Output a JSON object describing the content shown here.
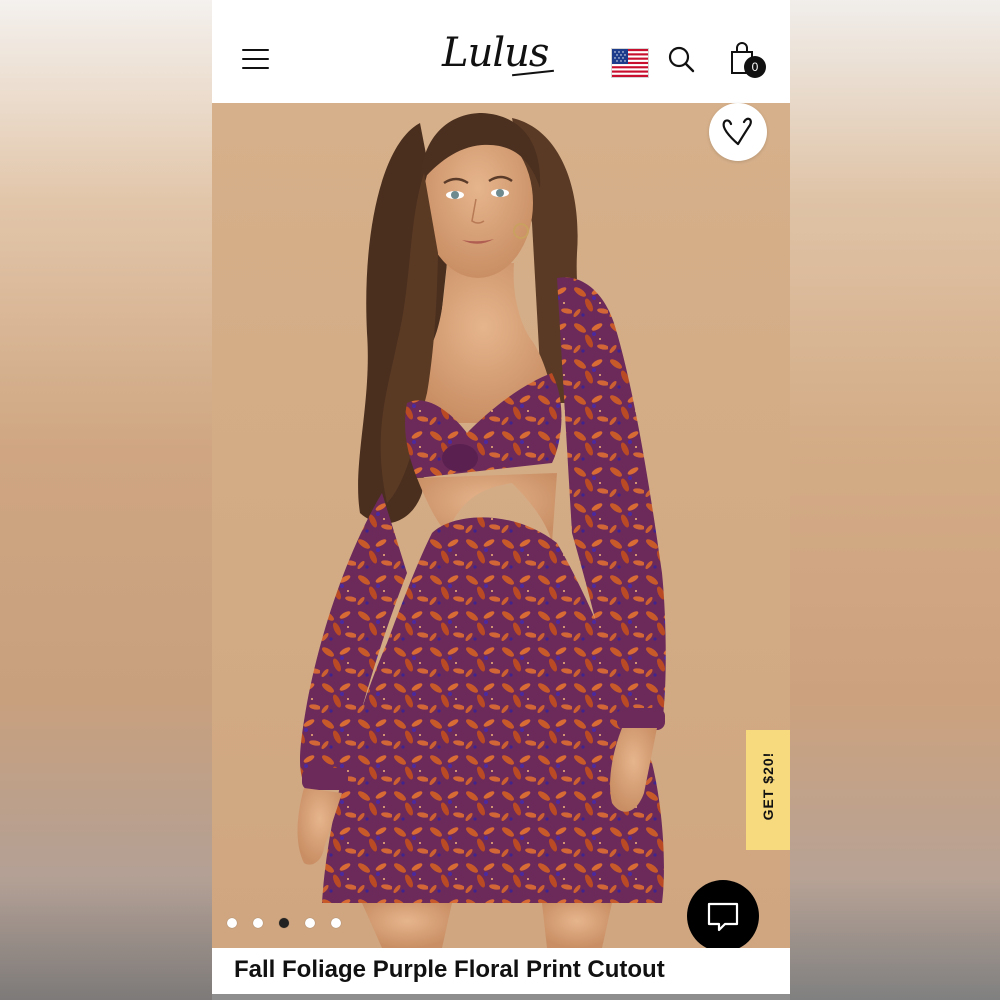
{
  "header": {
    "menu_icon": "hamburger-icon",
    "logo_text": "Lulus",
    "flag_icon": "us-flag-icon",
    "search_icon": "search-icon",
    "bag_icon": "shopping-bag-icon",
    "bag_count": "0"
  },
  "hero": {
    "wishlist_icon": "heart-icon",
    "promo_label": "GET $20!",
    "chat_icon": "chat-icon",
    "carousel_total": 5,
    "carousel_active_index": 3
  },
  "product": {
    "title": "Fall Foliage Purple Floral Print Cutout"
  },
  "colors": {
    "background": "#d8b48f",
    "promo": "#f7d97e",
    "dress_primary": "#6a2a5d",
    "dress_accent": "#c85a2a",
    "chat_button": "#000000"
  }
}
